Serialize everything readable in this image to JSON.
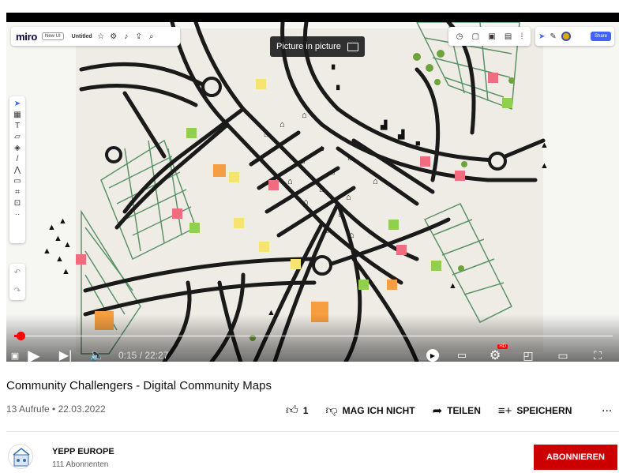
{
  "video": {
    "miro": {
      "logo": "miro",
      "badge": "New UI",
      "board_name": "Untitled",
      "share_label": "Share"
    },
    "pip_tooltip": "Picture in picture",
    "time": "0:15 / 22:27",
    "progress": 0.011,
    "icons": [
      "play-icon",
      "next-icon",
      "volume-icon",
      "autoplay-icon",
      "subtitles-icon",
      "settings-icon",
      "miniplayer-icon",
      "theater-icon",
      "fullscreen-icon"
    ]
  },
  "info": {
    "title": "Community Challengers - Digital Community Maps",
    "meta": "13 Aufrufe • 22.03.2022",
    "like_count": "1",
    "dislike_label": "MAG ICH NICHT",
    "share_label": "TEILEN",
    "save_label": "SPEICHERN",
    "more": "..."
  },
  "channel": {
    "name": "YEPP EUROPE",
    "subscribers": "111 Abonnenten",
    "subscribe_label": "ABONNIEREN"
  },
  "colors": {
    "subscribe": "#cc0000",
    "progress": "#ff0000",
    "miro_share": "#4262ff"
  }
}
